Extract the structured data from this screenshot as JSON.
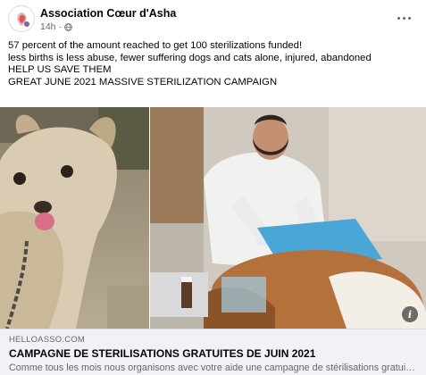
{
  "post": {
    "page_name": "Association Cœur d'Asha",
    "time": "14h",
    "separator": "·",
    "lines": [
      "57 percent of the amount reached to get 100 sterilizations funded!",
      "less births is less abuse, fewer suffering dogs and cats alone, injured, abandoned",
      "HELP US SAVE THEM",
      "GREAT JUNE 2021 MASSIVE STERILIZATION CAMPAIGN"
    ]
  },
  "link": {
    "domain": "HELLOASSO.COM",
    "title": "CAMPAGNE DE STERILISATIONS GRATUITES DE JUIN 2021",
    "description": "Comme tous les mois nous organisons avec votre aide une campagne de stérilisations gratuit..."
  },
  "icons": {
    "more": "more-horizontal-icon",
    "globe": "globe-icon",
    "info": "info-icon"
  },
  "info_glyph": "i",
  "colors": {
    "text": "#050505",
    "secondary": "#65676b",
    "link_bg": "#f0f2f5"
  }
}
